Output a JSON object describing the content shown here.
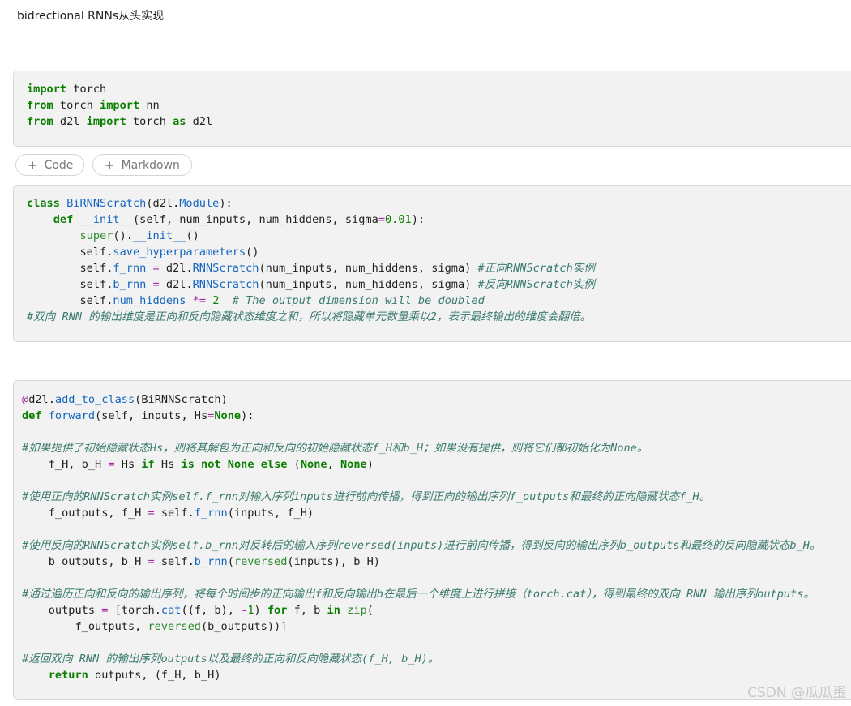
{
  "heading": "bidrectional RNNs从头实现",
  "buttons": {
    "code": "Code",
    "markdown": "Markdown"
  },
  "watermark": "CSDN @瓜瓜蛋",
  "cells": [
    {
      "id": "cell-1",
      "lines": [
        "import torch",
        "from torch import nn",
        "from d2l import torch as d2l"
      ]
    },
    {
      "id": "cell-2",
      "lines": [
        "class BiRNNScratch(d2l.Module):",
        "    def __init__(self, num_inputs, num_hiddens, sigma=0.01):",
        "        super().__init__()",
        "        self.save_hyperparameters()",
        "        self.f_rnn = d2l.RNNScratch(num_inputs, num_hiddens, sigma) #正向RNNScratch实例",
        "        self.b_rnn = d2l.RNNScratch(num_inputs, num_hiddens, sigma) #反向RNNScratch实例",
        "        self.num_hiddens *= 2  # The output dimension will be doubled",
        "#双向 RNN 的输出维度是正向和反向隐藏状态维度之和，所以将隐藏单元数量乘以2，表示最终输出的维度会翻倍。"
      ]
    },
    {
      "id": "cell-3",
      "lines": [
        "@d2l.add_to_class(BiRNNScratch)",
        "def forward(self, inputs, Hs=None):",
        "",
        "#如果提供了初始隐藏状态Hs，则将其解包为正向和反向的初始隐藏状态f_H和b_H；如果没有提供，则将它们都初始化为None。",
        "    f_H, b_H = Hs if Hs is not None else (None, None)",
        "",
        "#使用正向的RNNScratch实例self.f_rnn对输入序列inputs进行前向传播，得到正向的输出序列f_outputs和最终的正向隐藏状态f_H。",
        "    f_outputs, f_H = self.f_rnn(inputs, f_H)",
        "",
        "#使用反向的RNNScratch实例self.b_rnn对反转后的输入序列reversed(inputs)进行前向传播，得到反向的输出序列b_outputs和最终的反向隐藏状态b_H。",
        "    b_outputs, b_H = self.b_rnn(reversed(inputs), b_H)",
        "",
        "#通过遍历正向和反向的输出序列，将每个时间步的正向输出f和反向输出b在最后一个维度上进行拼接（torch.cat），得到最终的双向 RNN 输出序列outputs。",
        "    outputs = [torch.cat((f, b), -1) for f, b in zip(",
        "        f_outputs, reversed(b_outputs))]",
        "",
        "#返回双向 RNN 的输出序列outputs以及最终的正向和反向隐藏状态(f_H, b_H)。",
        "    return outputs, (f_H, b_H)"
      ]
    }
  ]
}
